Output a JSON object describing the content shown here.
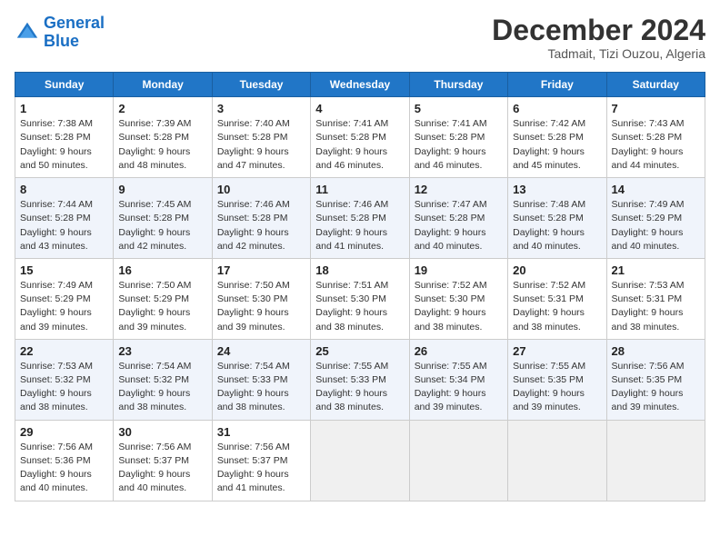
{
  "header": {
    "logo_line1": "General",
    "logo_line2": "Blue",
    "month": "December 2024",
    "location": "Tadmait, Tizi Ouzou, Algeria"
  },
  "weekdays": [
    "Sunday",
    "Monday",
    "Tuesday",
    "Wednesday",
    "Thursday",
    "Friday",
    "Saturday"
  ],
  "weeks": [
    [
      {
        "day": "1",
        "info": "Sunrise: 7:38 AM\nSunset: 5:28 PM\nDaylight: 9 hours\nand 50 minutes."
      },
      {
        "day": "2",
        "info": "Sunrise: 7:39 AM\nSunset: 5:28 PM\nDaylight: 9 hours\nand 48 minutes."
      },
      {
        "day": "3",
        "info": "Sunrise: 7:40 AM\nSunset: 5:28 PM\nDaylight: 9 hours\nand 47 minutes."
      },
      {
        "day": "4",
        "info": "Sunrise: 7:41 AM\nSunset: 5:28 PM\nDaylight: 9 hours\nand 46 minutes."
      },
      {
        "day": "5",
        "info": "Sunrise: 7:41 AM\nSunset: 5:28 PM\nDaylight: 9 hours\nand 46 minutes."
      },
      {
        "day": "6",
        "info": "Sunrise: 7:42 AM\nSunset: 5:28 PM\nDaylight: 9 hours\nand 45 minutes."
      },
      {
        "day": "7",
        "info": "Sunrise: 7:43 AM\nSunset: 5:28 PM\nDaylight: 9 hours\nand 44 minutes."
      }
    ],
    [
      {
        "day": "8",
        "info": "Sunrise: 7:44 AM\nSunset: 5:28 PM\nDaylight: 9 hours\nand 43 minutes."
      },
      {
        "day": "9",
        "info": "Sunrise: 7:45 AM\nSunset: 5:28 PM\nDaylight: 9 hours\nand 42 minutes."
      },
      {
        "day": "10",
        "info": "Sunrise: 7:46 AM\nSunset: 5:28 PM\nDaylight: 9 hours\nand 42 minutes."
      },
      {
        "day": "11",
        "info": "Sunrise: 7:46 AM\nSunset: 5:28 PM\nDaylight: 9 hours\nand 41 minutes."
      },
      {
        "day": "12",
        "info": "Sunrise: 7:47 AM\nSunset: 5:28 PM\nDaylight: 9 hours\nand 40 minutes."
      },
      {
        "day": "13",
        "info": "Sunrise: 7:48 AM\nSunset: 5:28 PM\nDaylight: 9 hours\nand 40 minutes."
      },
      {
        "day": "14",
        "info": "Sunrise: 7:49 AM\nSunset: 5:29 PM\nDaylight: 9 hours\nand 40 minutes."
      }
    ],
    [
      {
        "day": "15",
        "info": "Sunrise: 7:49 AM\nSunset: 5:29 PM\nDaylight: 9 hours\nand 39 minutes."
      },
      {
        "day": "16",
        "info": "Sunrise: 7:50 AM\nSunset: 5:29 PM\nDaylight: 9 hours\nand 39 minutes."
      },
      {
        "day": "17",
        "info": "Sunrise: 7:50 AM\nSunset: 5:30 PM\nDaylight: 9 hours\nand 39 minutes."
      },
      {
        "day": "18",
        "info": "Sunrise: 7:51 AM\nSunset: 5:30 PM\nDaylight: 9 hours\nand 38 minutes."
      },
      {
        "day": "19",
        "info": "Sunrise: 7:52 AM\nSunset: 5:30 PM\nDaylight: 9 hours\nand 38 minutes."
      },
      {
        "day": "20",
        "info": "Sunrise: 7:52 AM\nSunset: 5:31 PM\nDaylight: 9 hours\nand 38 minutes."
      },
      {
        "day": "21",
        "info": "Sunrise: 7:53 AM\nSunset: 5:31 PM\nDaylight: 9 hours\nand 38 minutes."
      }
    ],
    [
      {
        "day": "22",
        "info": "Sunrise: 7:53 AM\nSunset: 5:32 PM\nDaylight: 9 hours\nand 38 minutes."
      },
      {
        "day": "23",
        "info": "Sunrise: 7:54 AM\nSunset: 5:32 PM\nDaylight: 9 hours\nand 38 minutes."
      },
      {
        "day": "24",
        "info": "Sunrise: 7:54 AM\nSunset: 5:33 PM\nDaylight: 9 hours\nand 38 minutes."
      },
      {
        "day": "25",
        "info": "Sunrise: 7:55 AM\nSunset: 5:33 PM\nDaylight: 9 hours\nand 38 minutes."
      },
      {
        "day": "26",
        "info": "Sunrise: 7:55 AM\nSunset: 5:34 PM\nDaylight: 9 hours\nand 39 minutes."
      },
      {
        "day": "27",
        "info": "Sunrise: 7:55 AM\nSunset: 5:35 PM\nDaylight: 9 hours\nand 39 minutes."
      },
      {
        "day": "28",
        "info": "Sunrise: 7:56 AM\nSunset: 5:35 PM\nDaylight: 9 hours\nand 39 minutes."
      }
    ],
    [
      {
        "day": "29",
        "info": "Sunrise: 7:56 AM\nSunset: 5:36 PM\nDaylight: 9 hours\nand 40 minutes."
      },
      {
        "day": "30",
        "info": "Sunrise: 7:56 AM\nSunset: 5:37 PM\nDaylight: 9 hours\nand 40 minutes."
      },
      {
        "day": "31",
        "info": "Sunrise: 7:56 AM\nSunset: 5:37 PM\nDaylight: 9 hours\nand 41 minutes."
      },
      null,
      null,
      null,
      null
    ]
  ]
}
